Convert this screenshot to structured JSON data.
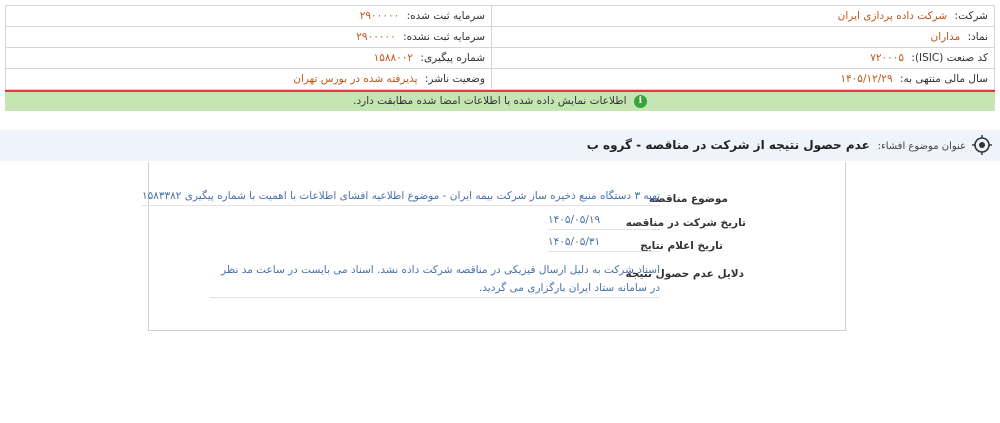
{
  "company_info": {
    "company_label": "شرکت:",
    "company_value": "شرکت داده پردازی ایران",
    "registered_capital_label": "سرمایه ثبت شده:",
    "registered_capital_value": "۲۹۰۰۰۰۰",
    "symbol_label": "نماد:",
    "symbol_value": "مداران",
    "unregistered_capital_label": "سرمایه ثبت نشده:",
    "unregistered_capital_value": "۲۹۰۰۰۰۰",
    "isic_label": "کد صنعت (ISIC):",
    "isic_value": "۷۲۰۰۰۵",
    "tracking_label": "شماره پیگیری:",
    "tracking_value": "۱۵۸۸۰۰۲",
    "fiscal_year_label": "سال مالی منتهی به:",
    "fiscal_year_value": "۱۴۰۵/۱۲/۲۹",
    "publisher_status_label": "وضعیت ناشر:",
    "publisher_status_value": "پذیرفته شده در بورس تهران"
  },
  "notice": {
    "text": "اطلاعات نمایش داده شده با اطلاعات امضا شده مطابقت دارد.",
    "icon": "info-icon"
  },
  "subject": {
    "label": "عنوان موضوع افشاء:",
    "title": "عدم حصول نتیجه از شرکت در مناقصه - گروه ب"
  },
  "details": {
    "topic_label": "موضوع مناقصه",
    "topic_value": "تهیه ۳ دستگاه منبع ذخیره ساز شرکت بیمه ایران - موضوع اطلاعیه افشای اطلاعات با اهمیت با شماره پیگیری ۱۵۸۳۳۸۲",
    "participation_date_label": "تاریخ شرکت در مناقصه",
    "participation_date_value": "۱۴۰۵/۰۵/۱۹",
    "result_date_label": "تاریخ اعلام نتایج",
    "result_date_value": "۱۴۰۵/۰۵/۳۱",
    "reasons_label": "دلایل عدم حصول نتیجه",
    "reasons_value": "اسناد شرکت به دلیل ارسال فیزیکی در مناقصه شرکت داده نشد. اسناد می بایست در ساعت مد نظر در سامانه ستاد ایران بارگزاری می گردید."
  },
  "colors": {
    "accent_value": "#c0561b",
    "link_blue": "#4a72a8",
    "notice_green": "#c5e6b4",
    "alert_red": "#e23b3b"
  }
}
